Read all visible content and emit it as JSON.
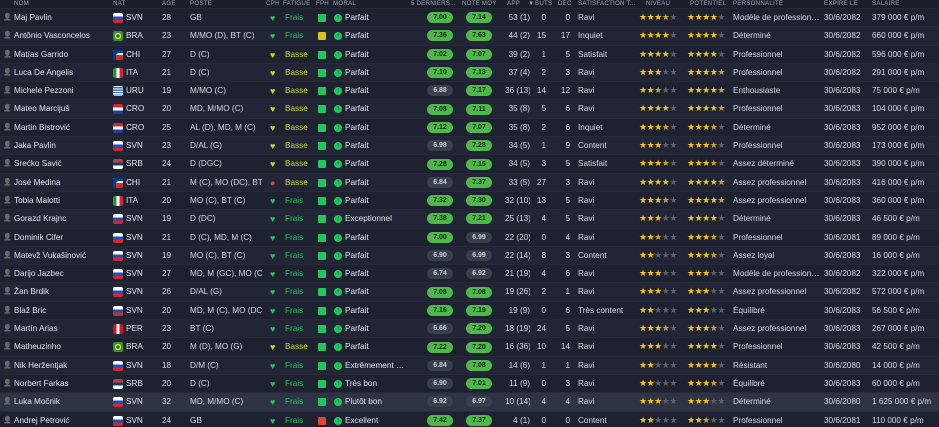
{
  "headers": {
    "name": "Nom",
    "nat": "NAT",
    "age": "ÂGE",
    "poste": "POSTE",
    "cph": "CPH",
    "fatigue": "FATIGUE",
    "fph": "FPH",
    "moral": "MORAL",
    "last5": "5 DERNIERS...",
    "notemoy": "NOTE MOY",
    "app": "APP",
    "buts": "BUTS",
    "dec": "DÉC",
    "satisfaction": "SATISFACTION T...",
    "niveau": "NIVEAU",
    "potentiel": "POTENTIEL",
    "personnalite": "PERSONNALITÉ",
    "expire": "EXPIRE LE",
    "salaire": "SALAIRE"
  },
  "colors": {
    "green": "#22c55e",
    "yellow": "#c9d81c",
    "red": "#e0443a",
    "pill_good": "#4fb84a",
    "pill_neutral": "#3a3f4c"
  },
  "players": [
    {
      "name": "Maj Pavlin",
      "nat": "SVN",
      "flag": "svn",
      "age": "28",
      "pos": "GB",
      "cph": "green",
      "fatigue": "Frais",
      "fph": "green",
      "moral_icon": "up",
      "moral": "Parfait",
      "last5": "7.00",
      "last5_good": true,
      "note": "7.14",
      "note_good": true,
      "app": "53 (1)",
      "buts": "0",
      "dec": "0",
      "sat": "Ravi",
      "niveau": 3.5,
      "potentiel": 4.0,
      "pers": "Modèle de professionn...",
      "exp": "30/6/2082",
      "sal": "379 000 € p/m"
    },
    {
      "name": "Antônio Vasconcelos",
      "nat": "BRA",
      "flag": "bra",
      "age": "23",
      "pos": "M/MO (D), BT (C)",
      "cph": "green",
      "fatigue": "Frais",
      "fph": "yellow",
      "moral_icon": "up",
      "moral": "Parfait",
      "last5": "7.36",
      "last5_good": true,
      "note": "7.63",
      "note_good": true,
      "app": "44 (2)",
      "buts": "15",
      "dec": "17",
      "sat": "Inquiet",
      "niveau": 4.0,
      "potentiel": 4.0,
      "pers": "Déterminé",
      "exp": "30/6/2082",
      "sal": "660 000 € p/m"
    },
    {
      "name": "Matías Garrido",
      "nat": "CHI",
      "flag": "chi",
      "age": "27",
      "pos": "D (C)",
      "cph": "green",
      "fatigue": "Basse",
      "fph": "green",
      "moral_icon": "up",
      "moral": "Parfait",
      "last5": "7.02",
      "last5_good": true,
      "note": "7.07",
      "note_good": true,
      "app": "39 (2)",
      "buts": "1",
      "dec": "5",
      "sat": "Satisfait",
      "niveau": 4.0,
      "potentiel": 4.0,
      "pers": "Professionnel",
      "exp": "30/6/2082",
      "sal": "596 000 € p/m"
    },
    {
      "name": "Luca De Angelis",
      "nat": "ITA",
      "flag": "ita",
      "age": "21",
      "pos": "D (C)",
      "cph": "green",
      "fatigue": "Basse",
      "fph": "green",
      "moral_icon": "up",
      "moral": "Parfait",
      "last5": "7.10",
      "last5_good": true,
      "note": "7.13",
      "note_good": true,
      "app": "37 (4)",
      "buts": "2",
      "dec": "3",
      "sat": "Ravi",
      "niveau": 3.0,
      "potentiel": 4.5,
      "pers": "Professionnel",
      "exp": "30/6/2082",
      "sal": "291 000 € p/m"
    },
    {
      "name": "Michele Pezzoni",
      "nat": "URU",
      "flag": "uru",
      "age": "19",
      "pos": "M/MO (C)",
      "cph": "green",
      "fatigue": "Basse",
      "fph": "green",
      "moral_icon": "up",
      "moral": "Parfait",
      "last5": "6.88",
      "last5_good": false,
      "note": "7.17",
      "note_good": true,
      "app": "36 (13)",
      "buts": "14",
      "dec": "12",
      "sat": "Ravi",
      "niveau": 2.5,
      "potentiel": 4.5,
      "pers": "Enthousiaste",
      "exp": "30/6/2083",
      "sal": "75 000 € p/m"
    },
    {
      "name": "Mateo Marciјuš",
      "nat": "CRO",
      "flag": "cro",
      "age": "20",
      "pos": "MD, M/MO (C)",
      "cph": "green",
      "fatigue": "Basse",
      "fph": "green",
      "moral_icon": "up",
      "moral": "Parfait",
      "last5": "7.08",
      "last5_good": true,
      "note": "7.11",
      "note_good": true,
      "app": "35 (8)",
      "buts": "5",
      "dec": "6",
      "sat": "Ravi",
      "niveau": 4.0,
      "potentiel": 4.5,
      "pers": "Professionnel",
      "exp": "30/6/2083",
      "sal": "104 000 € p/m"
    },
    {
      "name": "Martin Bistrović",
      "nat": "CRO",
      "flag": "cro",
      "age": "25",
      "pos": "AL (D), MD, M (C)",
      "cph": "green",
      "fatigue": "Basse",
      "fph": "green",
      "moral_icon": "up",
      "moral": "Parfait",
      "last5": "7.12",
      "last5_good": true,
      "note": "7.07",
      "note_good": true,
      "app": "35 (8)",
      "buts": "2",
      "dec": "6",
      "sat": "Inquiet",
      "niveau": 3.5,
      "potentiel": 3.5,
      "pers": "Déterminé",
      "exp": "30/6/2083",
      "sal": "952 000 € p/m"
    },
    {
      "name": "Jaka Pavlin",
      "nat": "SVN",
      "flag": "svn",
      "age": "23",
      "pos": "D/AL (G)",
      "cph": "green",
      "fatigue": "Basse",
      "fph": "green",
      "moral_icon": "up",
      "moral": "Parfait",
      "last5": "6.98",
      "last5_good": false,
      "note": "7.28",
      "note_good": true,
      "app": "34 (5)",
      "buts": "1",
      "dec": "9",
      "sat": "Content",
      "niveau": 3.0,
      "potentiel": 3.5,
      "pers": "Professionnel",
      "exp": "30/6/2083",
      "sal": "173 000 € p/m"
    },
    {
      "name": "Srećko Savić",
      "nat": "SRB",
      "flag": "srb",
      "age": "24",
      "pos": "D (DGC)",
      "cph": "green",
      "fatigue": "Basse",
      "fph": "green",
      "moral_icon": "up",
      "moral": "Parfait",
      "last5": "7.28",
      "last5_good": true,
      "note": "7.15",
      "note_good": true,
      "app": "34 (5)",
      "buts": "3",
      "dec": "5",
      "sat": "Satisfait",
      "niveau": 3.5,
      "potentiel": 3.5,
      "pers": "Assez déterminé",
      "exp": "30/6/2083",
      "sal": "390 000 € p/m"
    },
    {
      "name": "José Medina",
      "nat": "CHI",
      "flag": "chi",
      "age": "21",
      "pos": "M (C), MO (DC), BT (C)",
      "cph": "red",
      "fatigue": "Basse",
      "fph": "green",
      "moral_icon": "up",
      "moral": "Parfait",
      "last5": "6.84",
      "last5_good": false,
      "note": "7.37",
      "note_good": true,
      "app": "33 (5)",
      "buts": "27",
      "dec": "3",
      "sat": "Ravi",
      "niveau": 4.0,
      "potentiel": 4.5,
      "pers": "Assez professionnel",
      "exp": "30/6/2083",
      "sal": "416 000 € p/m"
    },
    {
      "name": "Tobia Malotti",
      "nat": "ITA",
      "flag": "ita",
      "age": "20",
      "pos": "MO (C), BT (C)",
      "cph": "green",
      "fatigue": "Frais",
      "fph": "green",
      "moral_icon": "up",
      "moral": "Parfait",
      "last5": "7.32",
      "last5_good": true,
      "note": "7.30",
      "note_good": true,
      "app": "32 (10)",
      "buts": "13",
      "dec": "5",
      "sat": "Ravi",
      "niveau": 3.5,
      "potentiel": 4.5,
      "pers": "Assez professionnel",
      "exp": "30/6/2083",
      "sal": "360 000 € p/m"
    },
    {
      "name": "Gorazd Krajnc",
      "nat": "SVN",
      "flag": "svn",
      "age": "19",
      "pos": "D (DC)",
      "cph": "green",
      "fatigue": "Frais",
      "fph": "green",
      "moral_icon": "up",
      "moral": "Exceptionnel",
      "last5": "7.38",
      "last5_good": true,
      "note": "7.21",
      "note_good": true,
      "app": "25 (13)",
      "buts": "4",
      "dec": "5",
      "sat": "Ravi",
      "niveau": 3.0,
      "potentiel": 4.0,
      "pers": "Déterminé",
      "exp": "30/6/2083",
      "sal": "46 500 € p/m"
    },
    {
      "name": "Dominik Cifer",
      "nat": "SVN",
      "flag": "svn",
      "age": "21",
      "pos": "D (C), MD, M (C)",
      "cph": "green",
      "fatigue": "Frais",
      "fph": "green",
      "moral_icon": "up",
      "moral": "Parfait",
      "last5": "7.00",
      "last5_good": true,
      "note": "6.99",
      "note_good": false,
      "app": "22 (20)",
      "buts": "0",
      "dec": "4",
      "sat": "Ravi",
      "niveau": 2.5,
      "potentiel": 3.5,
      "pers": "Professionnel",
      "exp": "30/6/2081",
      "sal": "89 000 € p/m"
    },
    {
      "name": "Matevž Vukašinović",
      "nat": "SVN",
      "flag": "svn",
      "age": "19",
      "pos": "MO (C), BT (C)",
      "cph": "green",
      "fatigue": "Frais",
      "fph": "green",
      "moral_icon": "up",
      "moral": "Parfait",
      "last5": "6.90",
      "last5_good": false,
      "note": "6.99",
      "note_good": false,
      "app": "22 (14)",
      "buts": "8",
      "dec": "3",
      "sat": "Content",
      "niveau": 2.0,
      "potentiel": 3.5,
      "pers": "Assez loyal",
      "exp": "30/6/2083",
      "sal": "16 000 € p/m"
    },
    {
      "name": "Darijo Jazbec",
      "nat": "SVN",
      "flag": "svn",
      "age": "27",
      "pos": "MD, M (GC), MO (C)",
      "cph": "green",
      "fatigue": "Frais",
      "fph": "green",
      "moral_icon": "up",
      "moral": "Parfait",
      "last5": "6.74",
      "last5_good": false,
      "note": "6.92",
      "note_good": false,
      "app": "21 (19)",
      "buts": "4",
      "dec": "6",
      "sat": "Ravi",
      "niveau": 3.0,
      "potentiel": 3.0,
      "pers": "Modèle de professionn...",
      "exp": "30/6/2082",
      "sal": "322 000 € p/m"
    },
    {
      "name": "Žan Brdik",
      "nat": "SVN",
      "flag": "svn",
      "age": "26",
      "pos": "D/AL (G)",
      "cph": "green",
      "fatigue": "Frais",
      "fph": "green",
      "moral_icon": "up",
      "moral": "Parfait",
      "last5": "7.08",
      "last5_good": true,
      "note": "7.08",
      "note_good": true,
      "app": "19 (26)",
      "buts": "2",
      "dec": "1",
      "sat": "Ravi",
      "niveau": 3.0,
      "potentiel": 3.0,
      "pers": "Assez professionnel",
      "exp": "30/6/2082",
      "sal": "572 000 € p/m"
    },
    {
      "name": "Blaž Bric",
      "nat": "SVN",
      "flag": "svn",
      "age": "20",
      "pos": "MD, M (C), MO (DC)",
      "cph": "green",
      "fatigue": "Frais",
      "fph": "green",
      "moral_icon": "up",
      "moral": "Parfait",
      "last5": "7.16",
      "last5_good": true,
      "note": "7.19",
      "note_good": true,
      "app": "19 (9)",
      "buts": "0",
      "dec": "6",
      "sat": "Très content",
      "niveau": 2.0,
      "potentiel": 3.0,
      "pers": "Équilibré",
      "exp": "30/6/2083",
      "sal": "56 500 € p/m"
    },
    {
      "name": "Martín Arias",
      "nat": "PER",
      "flag": "per",
      "age": "23",
      "pos": "BT (C)",
      "cph": "green",
      "fatigue": "Frais",
      "fph": "green",
      "moral_icon": "up",
      "moral": "Parfait",
      "last5": "6.66",
      "last5_good": false,
      "note": "7.20",
      "note_good": true,
      "app": "18 (19)",
      "buts": "24",
      "dec": "5",
      "sat": "Ravi",
      "niveau": 3.5,
      "potentiel": 3.5,
      "pers": "Assez professionnel",
      "exp": "30/6/2083",
      "sal": "267 000 € p/m"
    },
    {
      "name": "Matheuzinho",
      "nat": "BRA",
      "flag": "bra",
      "age": "20",
      "pos": "M (D), MO (G)",
      "cph": "green",
      "fatigue": "Basse",
      "fph": "green",
      "moral_icon": "up",
      "moral": "Parfait",
      "last5": "7.22",
      "last5_good": true,
      "note": "7.20",
      "note_good": true,
      "app": "16 (36)",
      "buts": "10",
      "dec": "14",
      "sat": "Ravi",
      "niveau": 3.0,
      "potentiel": 4.0,
      "pers": "Professionnel",
      "exp": "30/6/2083",
      "sal": "42 500 € p/m"
    },
    {
      "name": "Nik Heržentjak",
      "nat": "SVN",
      "flag": "svn",
      "age": "18",
      "pos": "D/M (C)",
      "cph": "green",
      "fatigue": "Frais",
      "fph": "green",
      "moral_icon": "up",
      "moral": "Extrêmement b...",
      "last5": "6.84",
      "last5_good": false,
      "note": "7.08",
      "note_good": true,
      "app": "14 (6)",
      "buts": "1",
      "dec": "1",
      "sat": "Ravi",
      "niveau": 2.0,
      "potentiel": 4.0,
      "pers": "Résistant",
      "exp": "30/6/2080",
      "sal": "14 000 € p/m"
    },
    {
      "name": "Norbert Farkas",
      "nat": "SRB",
      "flag": "srb",
      "age": "20",
      "pos": "D (C)",
      "cph": "green",
      "fatigue": "Frais",
      "fph": "green",
      "moral_icon": "up",
      "moral": "Très bon",
      "last5": "6.90",
      "last5_good": false,
      "note": "7.01",
      "note_good": true,
      "app": "11 (9)",
      "buts": "0",
      "dec": "3",
      "sat": "Ravi",
      "niveau": 2.0,
      "potentiel": 3.5,
      "pers": "Équilibré",
      "exp": "30/6/2083",
      "sal": "60 000 € p/m"
    },
    {
      "name": "Luka Močnik",
      "nat": "SVN",
      "flag": "svn",
      "age": "32",
      "pos": "MD, M/MO (C)",
      "cph": "green",
      "fatigue": "Frais",
      "fph": "green",
      "moral_icon": "up",
      "moral": "Plutôt bon",
      "last5": "6.92",
      "last5_good": false,
      "note": "6.97",
      "note_good": false,
      "app": "10 (14)",
      "buts": "4",
      "dec": "4",
      "sat": "Ravi",
      "niveau": 3.0,
      "potentiel": 3.0,
      "pers": "Déterminé",
      "exp": "30/6/2080",
      "sal": "1 625 000 € p/m",
      "selected": true
    },
    {
      "name": "Andrej Petrović",
      "nat": "SVN",
      "flag": "svn",
      "age": "24",
      "pos": "GB",
      "cph": "green",
      "fatigue": "Frais",
      "fph": "red",
      "moral_icon": "up",
      "moral": "Excellent",
      "last5": "7.42",
      "last5_good": true,
      "note": "7.37",
      "note_good": true,
      "app": "4 (1)",
      "buts": "0",
      "dec": "0",
      "sat": "Content",
      "niveau": 2.0,
      "potentiel": 2.5,
      "pers": "Professionnel",
      "exp": "30/6/2081",
      "sal": "110 000 € p/m"
    }
  ]
}
